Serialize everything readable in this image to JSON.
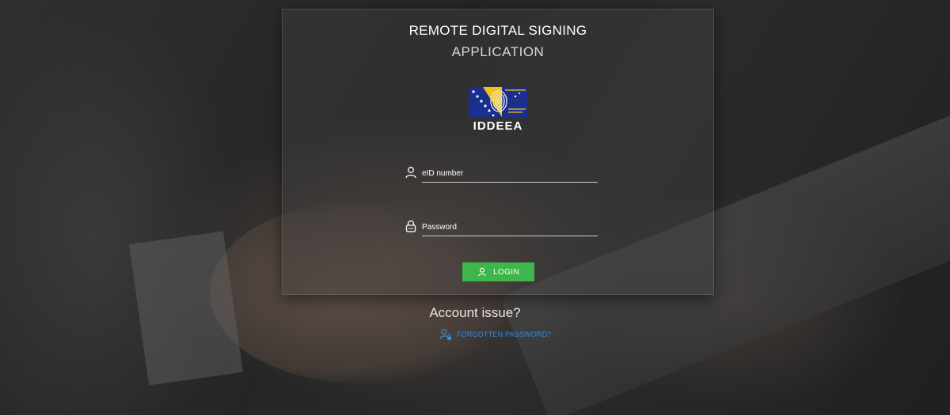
{
  "header": {
    "title": "REMOTE DIGITAL SIGNING",
    "subtitle": "APPLICATION"
  },
  "logo": {
    "text": "IDDEEA",
    "icon": "iddeea-fingerprint-flag-logo",
    "colors": {
      "flag_blue": "#1b2f8c",
      "flag_yellow": "#f2c21b"
    }
  },
  "form": {
    "eid": {
      "placeholder": "eID number",
      "value": "",
      "icon": "user-icon"
    },
    "password": {
      "placeholder": "Password",
      "value": "",
      "icon": "lock-icon"
    },
    "login_label": "LOGIN",
    "login_icon": "user-icon",
    "login_color": "#3eb64b"
  },
  "help": {
    "account_issue": "Account issue?",
    "forgot_label": "FORGOTTEN PASSWORD?",
    "forgot_icon": "user-lock-icon",
    "link_color": "#2f8ee0"
  }
}
